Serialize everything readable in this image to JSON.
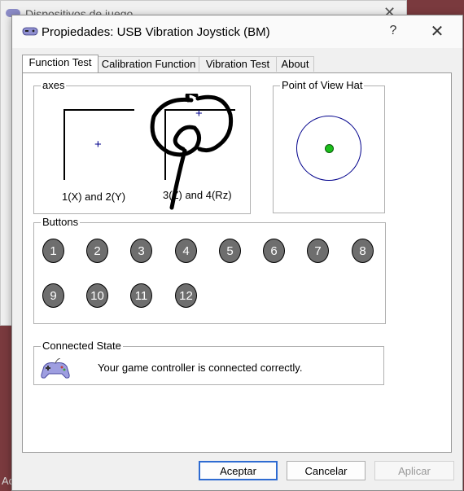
{
  "background_window": {
    "title": "Dispositivos de juego",
    "close_glyph": "✕",
    "fragment_text": "Ac"
  },
  "dialog": {
    "title": "Propiedades: USB Vibration Joystick (BM)",
    "help_glyph": "?",
    "close_glyph": "✕",
    "title_icon": "gamepad-icon"
  },
  "tabs": [
    {
      "label": "Function Test",
      "active": true
    },
    {
      "label": "Calibration Function",
      "active": false
    },
    {
      "label": "Vibration Test",
      "active": false
    },
    {
      "label": "About",
      "active": false
    }
  ],
  "axes": {
    "legend": "axes",
    "crosshair_glyph": "+",
    "plot1_label": "1(X) and 2(Y)",
    "plot2_label": "3(Z) and 4(Rz)"
  },
  "pov_hat": {
    "legend": "Point of View Hat",
    "colors": {
      "ring": "#00008b",
      "dot": "#1bbf1b"
    }
  },
  "buttons_group": {
    "legend": "Buttons",
    "buttons": [
      "1",
      "2",
      "3",
      "4",
      "5",
      "6",
      "7",
      "8",
      "9",
      "10",
      "11",
      "12"
    ]
  },
  "connected_state": {
    "legend": "Connected State",
    "message": "Your game controller is connected correctly.",
    "icon": "gamepad-icon"
  },
  "footer": {
    "ok_label": "Aceptar",
    "cancel_label": "Cancelar",
    "apply_label": "Aplicar",
    "apply_enabled": false
  },
  "colors": {
    "accent": "#2e6bd1",
    "crosshair": "#00008b",
    "joystick_button": "#6e6e6e"
  }
}
